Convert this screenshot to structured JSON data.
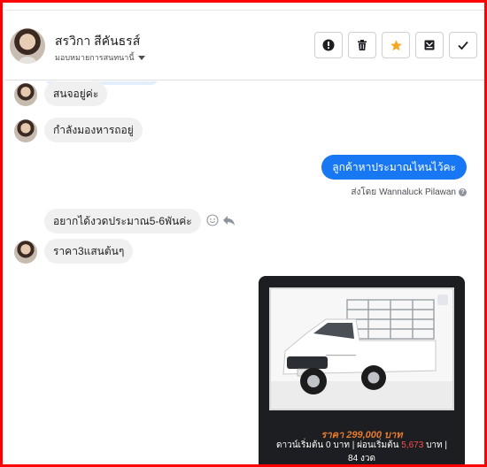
{
  "header": {
    "contact_name": "สรวิกา สีคันธรส์",
    "assign_label": "มอบหมายการสนทนานี้",
    "actions": [
      {
        "icon": "alert-icon"
      },
      {
        "icon": "trash-icon"
      },
      {
        "icon": "star-icon"
      },
      {
        "icon": "archive-icon"
      },
      {
        "icon": "check-icon"
      }
    ]
  },
  "messages": {
    "m1": "สนจอยู่ค่ะ",
    "m2": "กำลังมองหารถอยู่",
    "m3": "ลูกค้าหาประมาณไหนไว้คะ",
    "m3_sent_by_prefix": "ส่งโดย",
    "m3_sent_by_name": "Wannaluck Pilawan",
    "m4": "อยากได้งวดประมาณ5-6พันค่ะ",
    "m5": "ราคา3แสนต้นๆ"
  },
  "card": {
    "price": "ราคา 299,000 บาท",
    "details_a": "ดาวน์เริ่มต้น 0 บาท | ผ่อนเริ่มต้น",
    "details_highlight": "5,673",
    "details_b": "บาท |",
    "details_c": "84 งวด"
  },
  "colors": {
    "accent": "#1877f2",
    "star": "#f5a623",
    "frame": "#ff0000",
    "card_bg": "#1c1e21",
    "price": "#e87a2d",
    "highlight": "#ff4d4d"
  }
}
